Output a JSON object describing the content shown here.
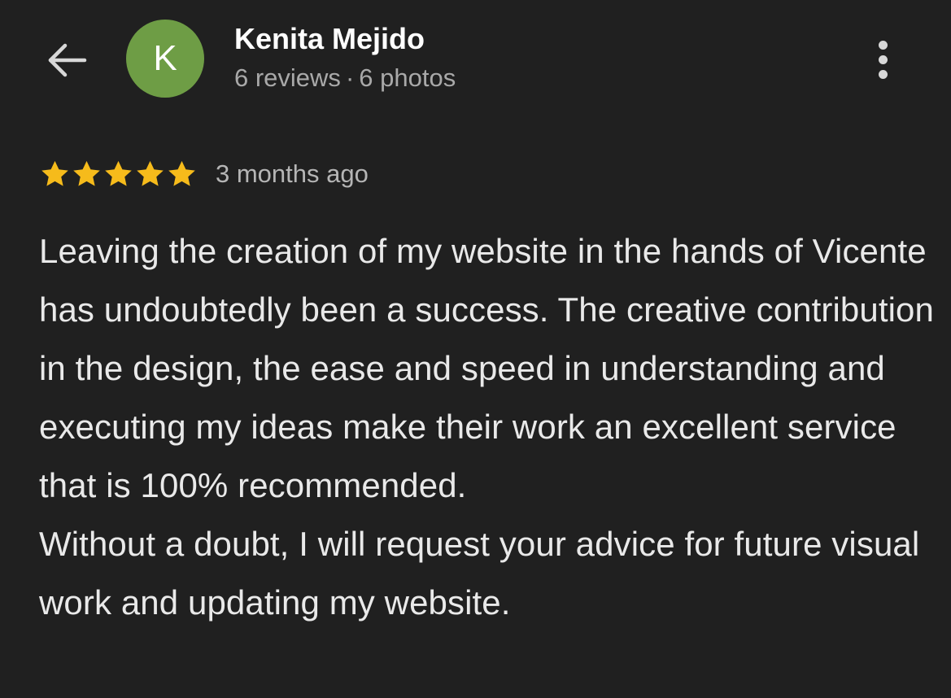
{
  "header": {
    "back_icon": "arrow-left-icon",
    "avatar_letter": "K",
    "avatar_color": "#6e9d45",
    "author_name": "Kenita Mejido",
    "reviews_count": "6 reviews",
    "separator": "·",
    "photos_count": "6 photos",
    "more_icon": "more-vertical-icon"
  },
  "review": {
    "rating": 5,
    "rating_max": 5,
    "star_color": "#f6bb1b",
    "timestamp": "3 months ago",
    "paragraph_1": "Leaving the creation of my website in the hands of Vicente has undoubtedly been a success. The creative contribution in the design, the ease and speed in understanding and executing my ideas make their work an excellent service that is 100% recommended.",
    "paragraph_2": "Without a doubt, I will request your advice for future visual work and updating my website."
  }
}
